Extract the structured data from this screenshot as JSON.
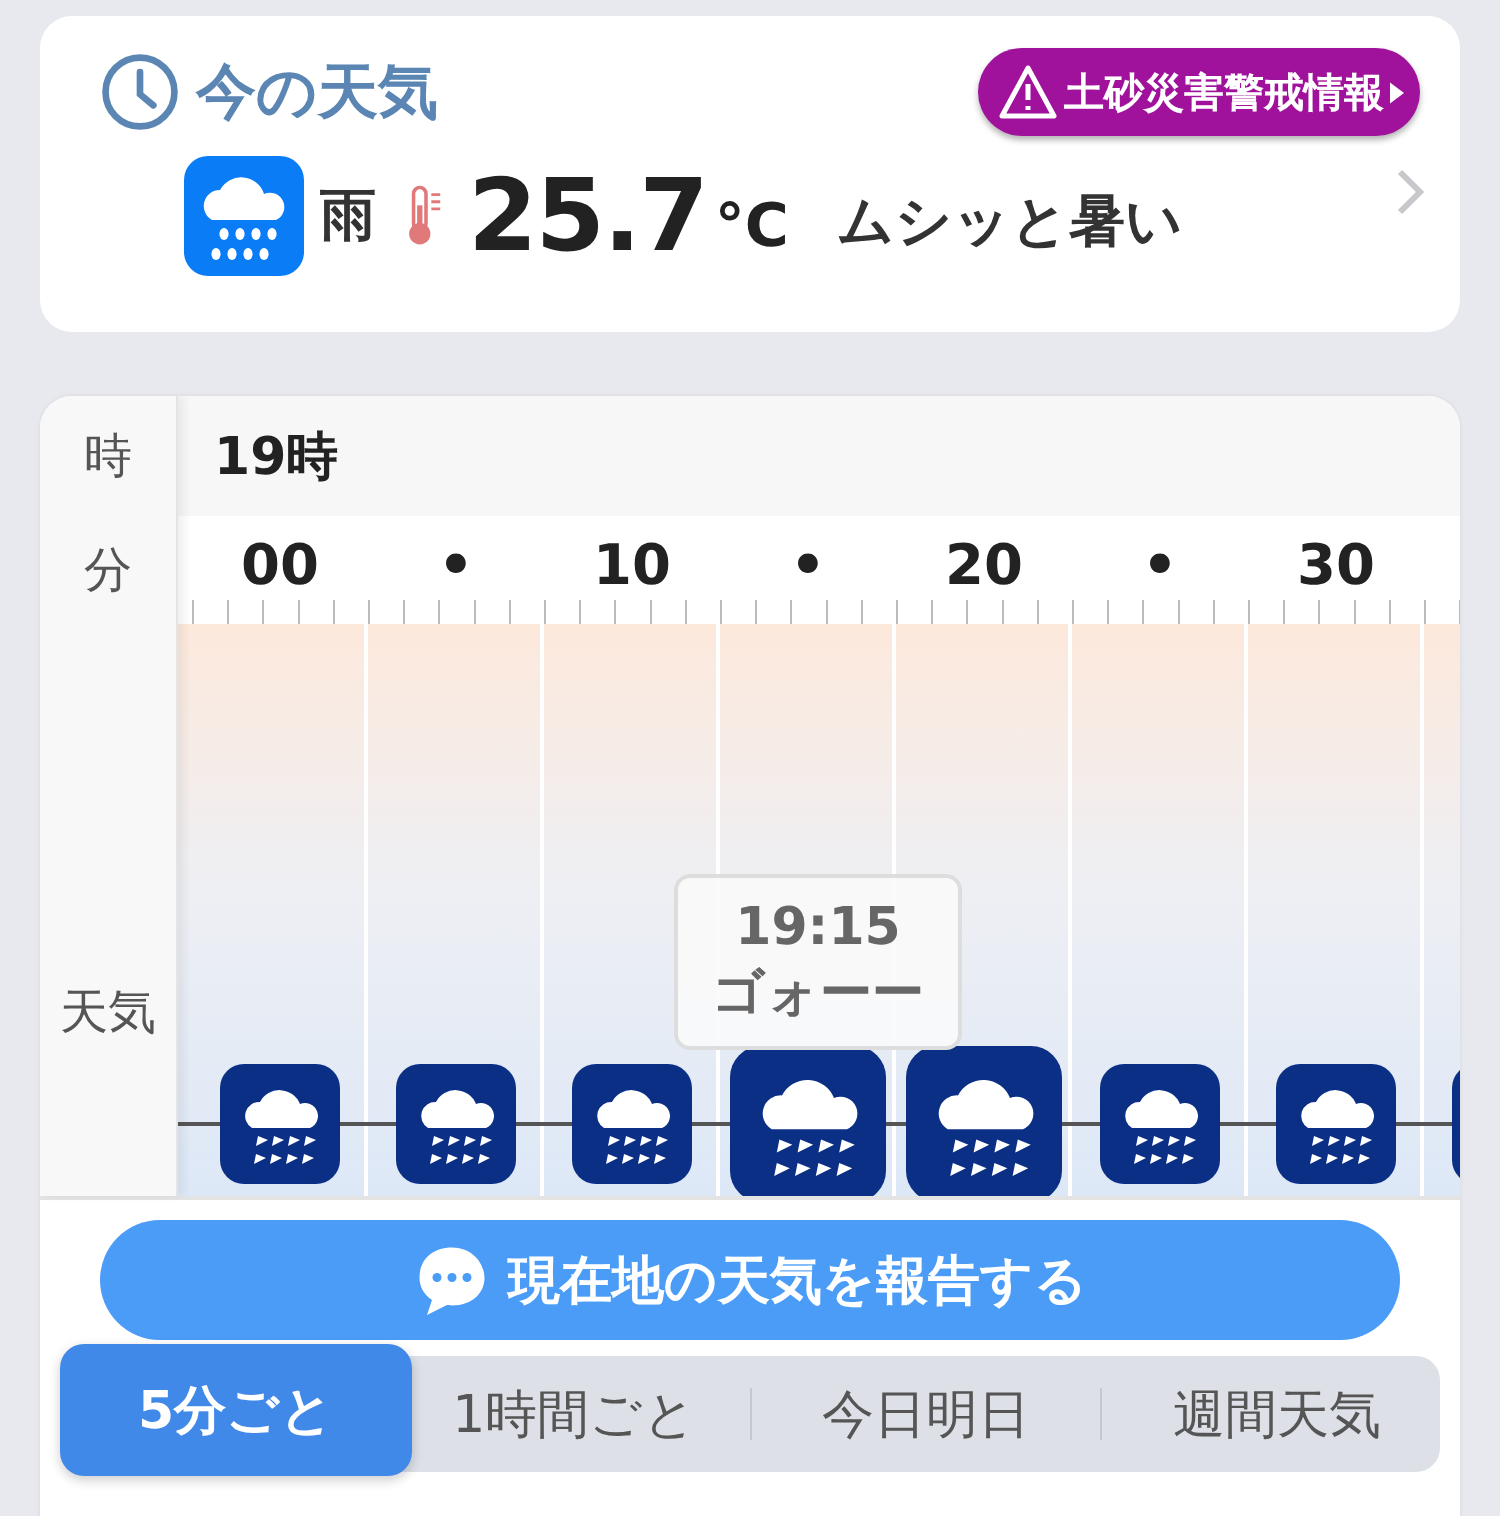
{
  "current": {
    "title": "今の天気",
    "alert": "土砂災害警戒情報",
    "weather": "雨",
    "temperature": "25.7",
    "unit": "°C",
    "feeling": "ムシッと暑い"
  },
  "timeline": {
    "hour_label": "時",
    "minute_label": "分",
    "weather_label": "天気",
    "hour": "19時",
    "minutes": [
      "00",
      "•",
      "10",
      "•",
      "20",
      "•",
      "30"
    ],
    "icons": [
      {
        "selected": false
      },
      {
        "selected": false
      },
      {
        "selected": false
      },
      {
        "selected": true
      },
      {
        "selected": true
      },
      {
        "selected": false
      },
      {
        "selected": false
      },
      {
        "selected": false
      }
    ],
    "tooltip": {
      "time": "19:15",
      "description": "ゴォーー"
    }
  },
  "report_button": "現在地の天気を報告する",
  "tabs": [
    {
      "label": "5分ごと",
      "selected": true
    },
    {
      "label": "1時間ごと",
      "selected": false
    },
    {
      "label": "今日明日",
      "selected": false
    },
    {
      "label": "週間天気",
      "selected": false
    }
  ]
}
